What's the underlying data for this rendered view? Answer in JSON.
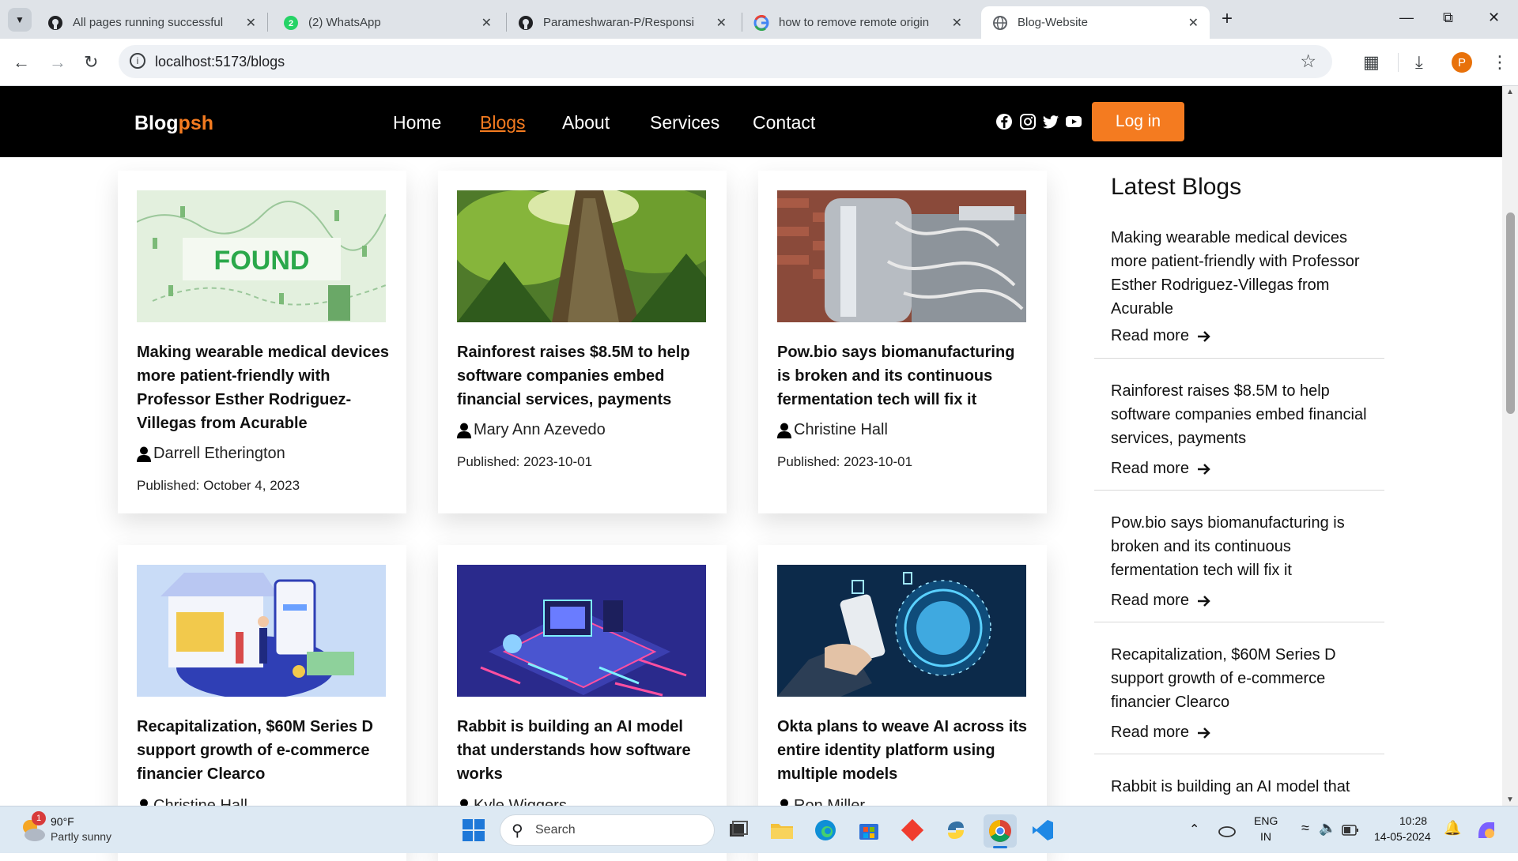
{
  "browser": {
    "tabs": [
      {
        "title": "All pages running successfully ·",
        "icon": "github-icon"
      },
      {
        "title": "(2) WhatsApp",
        "icon": "whatsapp-icon"
      },
      {
        "title": "Parameshwaran-P/Responsive-",
        "icon": "github-icon"
      },
      {
        "title": "how to remove remote origin g",
        "icon": "google-icon"
      },
      {
        "title": "Blog-Website",
        "icon": "globe-icon",
        "active": true
      }
    ],
    "url": "localhost:5173/blogs",
    "profile_initial": "P"
  },
  "site": {
    "logo_main": "Blog",
    "logo_accent": "psh",
    "nav": [
      "Home",
      "Blogs",
      "About",
      "Services",
      "Contact"
    ],
    "active_nav": "Blogs",
    "login_label": "Log in",
    "accent_color": "#f47b20"
  },
  "cards": [
    {
      "title": "Making wearable medical devices more patient-friendly with Professor Esther Rodriguez-Villegas from Acurable",
      "author": "Darrell Etherington",
      "published": "Published: October 4, 2023",
      "image": "found-illustration"
    },
    {
      "title": "Rainforest raises $8.5M to help software companies embed financial services, payments",
      "author": "Mary Ann Azevedo",
      "published": "Published: 2023-10-01",
      "image": "rainforest-tree"
    },
    {
      "title": "Pow.bio says biomanufacturing is broken and its continuous fermentation tech will fix it",
      "author": "Christine Hall",
      "published": "Published: 2023-10-01",
      "image": "bioreactor"
    },
    {
      "title": "Recapitalization, $60M Series D support growth of e-commerce financier Clearco",
      "author": "Christine Hall",
      "image": "storefront-illustration"
    },
    {
      "title": "Rabbit is building an AI model that understands how software works",
      "author": "Kyle Wiggers",
      "image": "circuit-illustration"
    },
    {
      "title": "Okta plans to weave AI across its entire identity platform using multiple models",
      "author": "Ron Miller",
      "image": "phone-globe"
    }
  ],
  "sidebar": {
    "heading": "Latest Blogs",
    "read_more": "Read more",
    "items": [
      "Making wearable medical devices more patient-friendly with Professor Esther Rodriguez-Villegas from Acurable",
      "Rainforest raises $8.5M to help software companies embed financial services, payments",
      "Pow.bio says biomanufacturing is broken and its continuous fermentation tech will fix it",
      "Recapitalization, $60M Series D support growth of e-commerce financier Clearco",
      "Rabbit is building an AI model that"
    ]
  },
  "taskbar": {
    "weather_temp": "90°F",
    "weather_desc": "Partly sunny",
    "weather_badge": "1",
    "search_label": "Search",
    "lang_top": "ENG",
    "lang_bottom": "IN",
    "time": "10:28",
    "date": "14-05-2024"
  }
}
